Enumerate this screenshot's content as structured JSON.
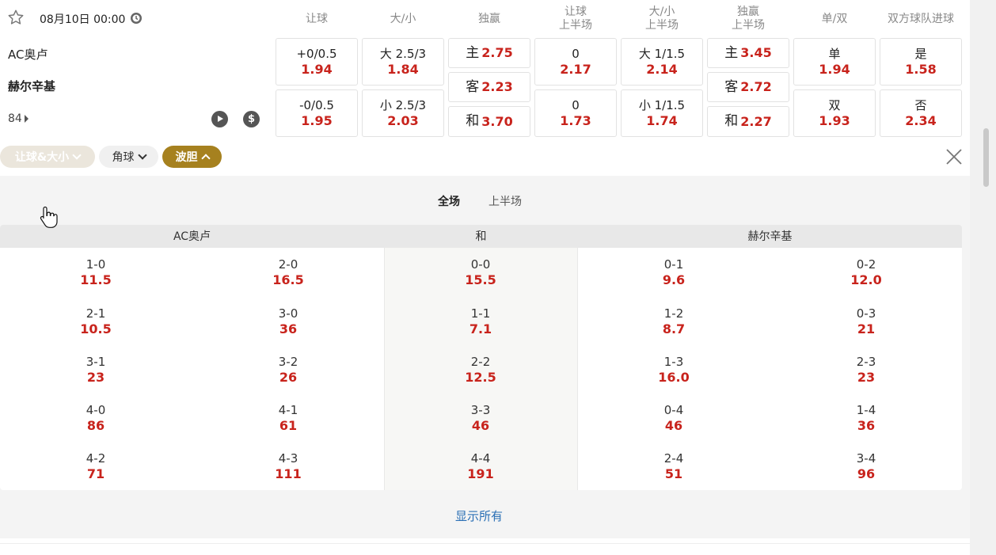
{
  "match": {
    "date_time": "08月10日 00:00",
    "home_team": "AC奥卢",
    "away_team": "赫尔辛基",
    "minute": "84"
  },
  "columns": [
    {
      "line1": "让球",
      "line2": ""
    },
    {
      "line1": "大/小",
      "line2": ""
    },
    {
      "line1": "独赢",
      "line2": ""
    },
    {
      "line1": "让球",
      "line2": "上半场"
    },
    {
      "line1": "大/小",
      "line2": "上半场"
    },
    {
      "line1": "独赢",
      "line2": "上半场"
    },
    {
      "line1": "单/双",
      "line2": ""
    },
    {
      "line1": "双方球队进球",
      "line2": ""
    }
  ],
  "markets": {
    "handicap": [
      {
        "label": "+0/0.5",
        "odd": "1.94"
      },
      {
        "label": "-0/0.5",
        "odd": "1.95"
      }
    ],
    "over_under": [
      {
        "label": "大 2.5/3",
        "odd": "1.84"
      },
      {
        "label": "小 2.5/3",
        "odd": "2.03"
      }
    ],
    "win": [
      {
        "label": "主",
        "odd": "2.75"
      },
      {
        "label": "客",
        "odd": "2.23"
      },
      {
        "label": "和",
        "odd": "3.70"
      }
    ],
    "handicap_1h": [
      {
        "label": "0",
        "odd": "2.17"
      },
      {
        "label": "0",
        "odd": "1.73"
      }
    ],
    "over_under_1h": [
      {
        "label": "大 1/1.5",
        "odd": "2.14"
      },
      {
        "label": "小 1/1.5",
        "odd": "1.74"
      }
    ],
    "win_1h": [
      {
        "label": "主",
        "odd": "3.45"
      },
      {
        "label": "客",
        "odd": "2.72"
      },
      {
        "label": "和",
        "odd": "2.27"
      }
    ],
    "odd_even": [
      {
        "label": "单",
        "odd": "1.94"
      },
      {
        "label": "双",
        "odd": "1.93"
      }
    ],
    "btts": [
      {
        "label": "是",
        "odd": "1.58"
      },
      {
        "label": "否",
        "odd": "2.34"
      }
    ]
  },
  "chips": {
    "handicap_ou": "让球&大小",
    "corners": "角球",
    "correct_score": "波胆"
  },
  "period_tabs": {
    "full": "全场",
    "first_half": "上半场"
  },
  "score_table": {
    "home_title": "AC奥卢",
    "draw_title": "和",
    "away_title": "赫尔辛基",
    "home_a": [
      {
        "score": "1-0",
        "odd": "11.5"
      },
      {
        "score": "2-1",
        "odd": "10.5"
      },
      {
        "score": "3-1",
        "odd": "23"
      },
      {
        "score": "4-0",
        "odd": "86"
      },
      {
        "score": "4-2",
        "odd": "71"
      }
    ],
    "home_b": [
      {
        "score": "2-0",
        "odd": "16.5"
      },
      {
        "score": "3-0",
        "odd": "36"
      },
      {
        "score": "3-2",
        "odd": "26"
      },
      {
        "score": "4-1",
        "odd": "61"
      },
      {
        "score": "4-3",
        "odd": "111"
      }
    ],
    "draw": [
      {
        "score": "0-0",
        "odd": "15.5"
      },
      {
        "score": "1-1",
        "odd": "7.1"
      },
      {
        "score": "2-2",
        "odd": "12.5"
      },
      {
        "score": "3-3",
        "odd": "46"
      },
      {
        "score": "4-4",
        "odd": "191"
      }
    ],
    "away_a": [
      {
        "score": "0-1",
        "odd": "9.6"
      },
      {
        "score": "1-2",
        "odd": "8.7"
      },
      {
        "score": "1-3",
        "odd": "16.0"
      },
      {
        "score": "0-4",
        "odd": "46"
      },
      {
        "score": "2-4",
        "odd": "51"
      }
    ],
    "away_b": [
      {
        "score": "0-2",
        "odd": "12.0"
      },
      {
        "score": "0-3",
        "odd": "21"
      },
      {
        "score": "2-3",
        "odd": "23"
      },
      {
        "score": "1-4",
        "odd": "36"
      },
      {
        "score": "3-4",
        "odd": "96"
      }
    ]
  },
  "show_all": "显示所有",
  "colors": {
    "odds_red": "#c8231c",
    "accent_gold": "#a6811f",
    "link_blue": "#2a6fb5"
  }
}
